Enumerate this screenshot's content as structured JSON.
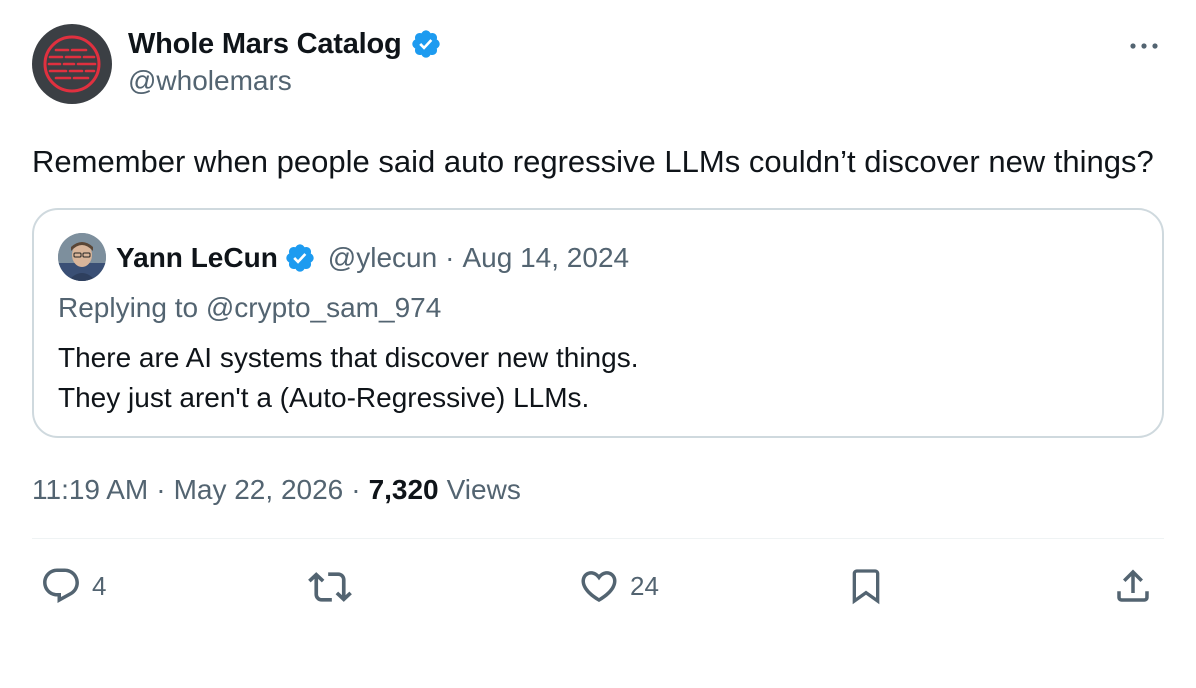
{
  "author": {
    "display_name": "Whole Mars Catalog",
    "handle": "@wholemars",
    "verified": true
  },
  "tweet": {
    "text": "Remember when people said auto regressive LLMs couldn’t discover new things?"
  },
  "quoted_tweet": {
    "display_name": "Yann LeCun",
    "handle": "@ylecun",
    "separator": "·",
    "date": "Aug 14, 2024",
    "replying_to": "Replying to @crypto_sam_974",
    "text_line1": "There are AI systems that discover new things.",
    "text_line2": "They just aren't a (Auto-Regressive) LLMs."
  },
  "meta": {
    "time": "11:19 AM",
    "separator": "·",
    "date": "May 22, 2026",
    "views_count": "7,320",
    "views_label": "Views"
  },
  "actions": {
    "replies": "4",
    "likes": "24"
  },
  "colors": {
    "verified_blue": "#1d9bf0",
    "secondary_text": "#536471",
    "border": "#cfd9de",
    "avatar_bg": "#3b3f44",
    "avatar_accent": "#e0303f"
  },
  "icons": {
    "more": "more-horizontal-icon",
    "reply": "reply-icon",
    "retweet": "retweet-icon",
    "like": "heart-icon",
    "bookmark": "bookmark-icon",
    "share": "share-icon",
    "verified": "verified-badge-icon"
  }
}
